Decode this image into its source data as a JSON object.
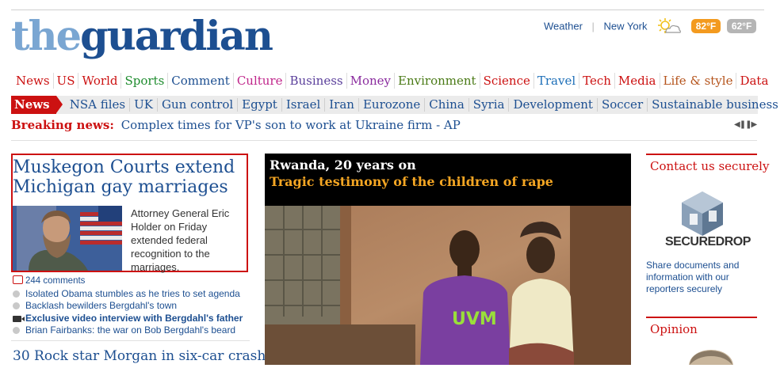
{
  "logo": {
    "the": "the",
    "guardian": "guardian"
  },
  "weather": {
    "link": "Weather",
    "city": "New York",
    "icon": "partly-cloudy-icon",
    "high": "82°F",
    "low": "62°F",
    "high_color": "#f39a1f",
    "low_color": "#b5b5b5"
  },
  "sections": [
    {
      "label": "News",
      "color": "#c11"
    },
    {
      "label": "US",
      "color": "#c11"
    },
    {
      "label": "World",
      "color": "#c11"
    },
    {
      "label": "Sports",
      "color": "#1e8c2e"
    },
    {
      "label": "Comment",
      "color": "#1d4f91"
    },
    {
      "label": "Culture",
      "color": "#c0268b"
    },
    {
      "label": "Business",
      "color": "#5a3f9b"
    },
    {
      "label": "Money",
      "color": "#8a2b9e"
    },
    {
      "label": "Environment",
      "color": "#4a7a16"
    },
    {
      "label": "Science",
      "color": "#c11"
    },
    {
      "label": "Travel",
      "color": "#1d6fb8"
    },
    {
      "label": "Tech",
      "color": "#c11"
    },
    {
      "label": "Media",
      "color": "#c11"
    },
    {
      "label": "Life & style",
      "color": "#b5541c"
    },
    {
      "label": "Data",
      "color": "#c11"
    }
  ],
  "subnav": {
    "lead": "News",
    "items": [
      "NSA files",
      "UK",
      "Gun control",
      "Egypt",
      "Israel",
      "Iran",
      "Eurozone",
      "China",
      "Syria",
      "Development",
      "Soccer",
      "Sustainable business"
    ]
  },
  "breaking": {
    "label": "Breaking news:",
    "text": "Complex times for VP's son to work at Ukraine firm - AP"
  },
  "lead_story": {
    "title": "Muskegon Courts extend Michigan gay marriages",
    "summary": "Attorney General Eric Holder on Friday extended federal recognition to the marriages.",
    "comments": "244 comments",
    "related": [
      {
        "text": "Isolated Obama stumbles as he tries to set agenda",
        "icon": "bullet-icon",
        "bold": false
      },
      {
        "text": "Backlash bewilders Bergdahl's town",
        "icon": "bullet-icon",
        "bold": false
      },
      {
        "text": "Exclusive video interview with Bergdahl's father",
        "icon": "video-camera-icon",
        "bold": true
      },
      {
        "text": "Brian Fairbanks: the war on Bob Bergdahl's beard",
        "icon": "bullet-icon",
        "bold": false
      }
    ]
  },
  "second_story": {
    "title": "30 Rock star Morgan in six-car crash"
  },
  "feature": {
    "kicker": "Rwanda, 20 years on",
    "title": "Tragic testimony of the children of rape",
    "shirt_text": "UVM"
  },
  "contact": {
    "title": "Contact us securely",
    "logo_word": "SECUREDROP",
    "text": "Share documents and information with our reporters securely"
  },
  "opinion": {
    "title": "Opinion"
  }
}
